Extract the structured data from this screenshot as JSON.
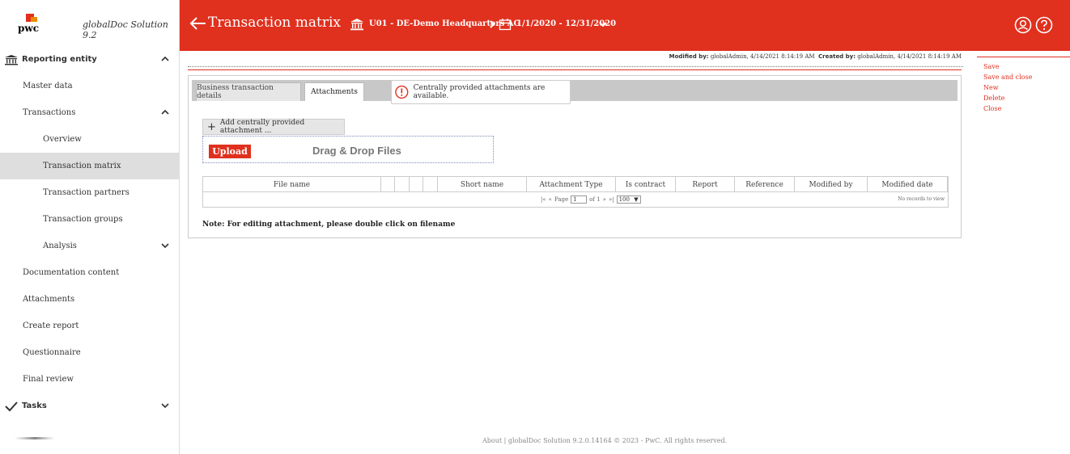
{
  "brand": {
    "logo_text": "pwc",
    "app_name": "globalDoc Solution 9.2"
  },
  "sidebar": {
    "section_title": "Reporting entity",
    "items": [
      {
        "label": "Master data"
      },
      {
        "label": "Transactions"
      },
      {
        "label": "Overview"
      },
      {
        "label": "Transaction matrix"
      },
      {
        "label": "Transaction partners"
      },
      {
        "label": "Transaction groups"
      },
      {
        "label": "Analysis"
      },
      {
        "label": "Documentation content"
      },
      {
        "label": "Attachments"
      },
      {
        "label": "Create report"
      },
      {
        "label": "Questionnaire"
      },
      {
        "label": "Final review"
      }
    ],
    "tasks_title": "Tasks"
  },
  "header": {
    "title": "Transaction matrix",
    "entity": "U01 - DE-Demo Headquarters AG",
    "period": "1/1/2020 - 12/31/2020"
  },
  "meta": {
    "modified_label": "Modified by:",
    "modified_value": "globalAdmin, 4/14/2021 8:14:19 AM",
    "created_label": "Created by:",
    "created_value": "globalAdmin, 4/14/2021 8:14:19 AM"
  },
  "actions": {
    "save": "Save",
    "save_close": "Save and close",
    "new": "New",
    "delete": "Delete",
    "close": "Close"
  },
  "tabs": {
    "details": "Business transaction details",
    "attachments": "Attachments"
  },
  "notice": "Centrally provided attachments are available.",
  "attach": {
    "add_label": "Add centrally provided attachment ...",
    "upload": "Upload",
    "dnd": "Drag & Drop Files"
  },
  "grid": {
    "columns": [
      "File name",
      "",
      "",
      "",
      "",
      "Short name",
      "Attachment Type",
      "Is contract",
      "Report",
      "Reference",
      "Modified by",
      "Modified date"
    ],
    "pager": {
      "page_label": "Page",
      "page_value": "1",
      "of_label": "of 1",
      "page_size": "100"
    },
    "no_records": "No records to view"
  },
  "note": "Note: For editing attachment, please double click on filename",
  "footer": "About |  globalDoc Solution 9.2.0.14164 © 2023 - PwC. All rights reserved."
}
